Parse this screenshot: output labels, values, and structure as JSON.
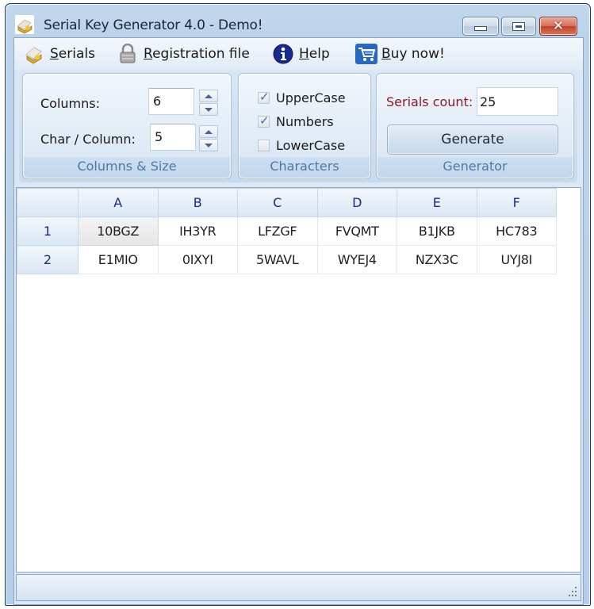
{
  "window": {
    "title": "Serial Key Generator 4.0 - Demo!",
    "controls": {
      "minimize": "minimize",
      "maximize": "maximize",
      "close": "close"
    }
  },
  "menu": {
    "items": [
      {
        "label": "Serials",
        "accel": "S",
        "icon": "serials-icon"
      },
      {
        "label": "Registration file",
        "accel": "R",
        "icon": "lock-icon"
      },
      {
        "label": "Help",
        "accel": "H",
        "icon": "info-icon"
      },
      {
        "label": "Buy now!",
        "accel": "B",
        "icon": "shopping-cart-icon"
      }
    ]
  },
  "ribbon": {
    "columns_size": {
      "title": "Columns & Size",
      "columns_label": "Columns:",
      "columns_value": "6",
      "chars_label": "Char / Column:",
      "chars_value": "5"
    },
    "characters": {
      "title": "Characters",
      "options": [
        {
          "label": "UpperCase",
          "checked": true
        },
        {
          "label": "Numbers",
          "checked": true
        },
        {
          "label": "LowerCase",
          "checked": false
        }
      ]
    },
    "generator": {
      "title": "Generator",
      "count_label": "Serials count:",
      "count_value": "25",
      "generate_label": "Generate",
      "count_label_color": "#8b1a24"
    }
  },
  "grid": {
    "columns": [
      "A",
      "B",
      "C",
      "D",
      "E",
      "F"
    ],
    "rows": [
      {
        "index": "1",
        "cells": [
          "10BGZ",
          "IH3YR",
          "LFZGF",
          "FVQMT",
          "B1JKB",
          "HC783"
        ]
      },
      {
        "index": "2",
        "cells": [
          "E1MIO",
          "0IXYI",
          "5WAVL",
          "WYEJ4",
          "NZX3C",
          "UYJ8I"
        ]
      }
    ],
    "selected_cell": "A1"
  }
}
